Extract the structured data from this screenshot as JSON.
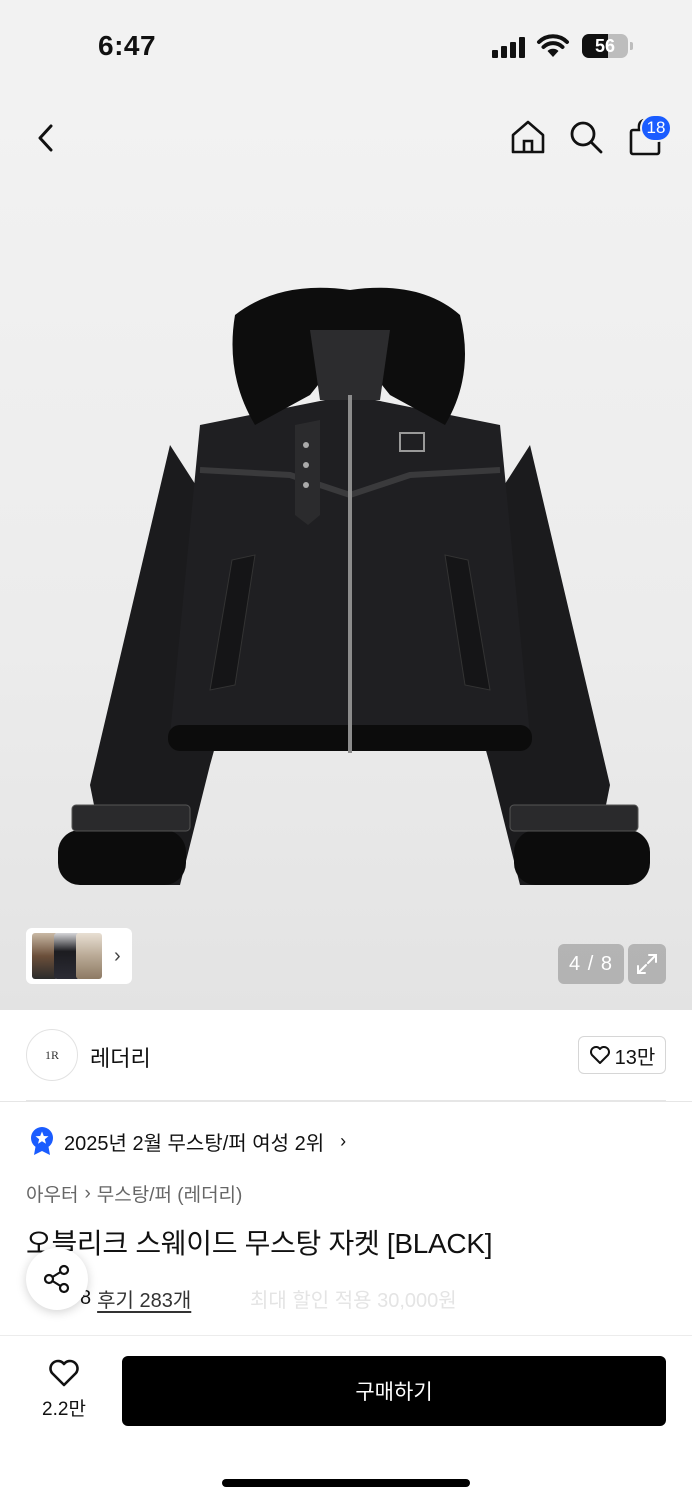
{
  "status_bar": {
    "time": "6:47",
    "battery": "56"
  },
  "header": {
    "cart_count": "18",
    "icons": {
      "back": "back-arrow-icon",
      "home": "home-icon",
      "search": "search-icon",
      "cart": "shopping-bag-icon"
    }
  },
  "gallery": {
    "pager": "4 / 8",
    "expand_icon": "expand-icon"
  },
  "brand": {
    "logo_text": "1R",
    "name": "레더리",
    "like_count": "13만"
  },
  "ranking": {
    "text": "2025년 2월 무스탕/퍼 여성 2위"
  },
  "breadcrumb": {
    "category": "아우터",
    "subcategory": "무스탕/퍼 (레더리)"
  },
  "product": {
    "title": "오블리크 스웨이드 무스탕 자켓 [BLACK]",
    "rating_suffix": "8",
    "review_text": "후기 283개",
    "obscured_text": "최대 할인 적용 30,000원"
  },
  "bottom": {
    "wish_count": "2.2만",
    "buy_label": "구매하기"
  },
  "colors": {
    "accent": "#1a5cff",
    "buy_button": "#000000"
  }
}
